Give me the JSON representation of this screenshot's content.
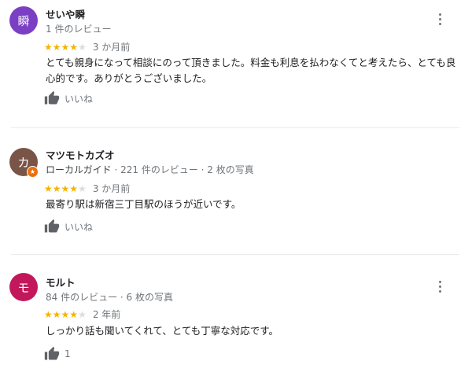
{
  "reviews": [
    {
      "avatar_letter": "瞬",
      "avatar_color": "#7b3fc4",
      "name": "せいや瞬",
      "meta": "1 件のレビュー",
      "rating": 4,
      "time": "3 か月前",
      "text": "とても親身になって相談にのって頂きました。料金も利息を払わなくてと考えたら、とても良心的です。ありがとうございました。",
      "like_label": "いいね"
    },
    {
      "avatar_letter": "カ",
      "avatar_color": "#795548",
      "badge": "★",
      "name": "マツモトカズオ",
      "meta_local": "ローカルガイド",
      "meta": " · 221 件のレビュー · 2 枚の写真",
      "rating": 4,
      "time": "3 か月前",
      "text": "最寄り駅は新宿三丁目駅のほうが近いです。",
      "like_label": "いいね"
    },
    {
      "avatar_letter": "モ",
      "avatar_color": "#c2185b",
      "name": "モルト",
      "meta": "84 件のレビュー · 6 枚の写真",
      "rating": 4,
      "time": "2 年前",
      "text": "しっかり話も聞いてくれて、とても丁寧な対応です。",
      "like_label": "1"
    }
  ],
  "colors": {
    "star": "#f4b400",
    "star_off": "#dadce0",
    "muted": "#70757a"
  }
}
